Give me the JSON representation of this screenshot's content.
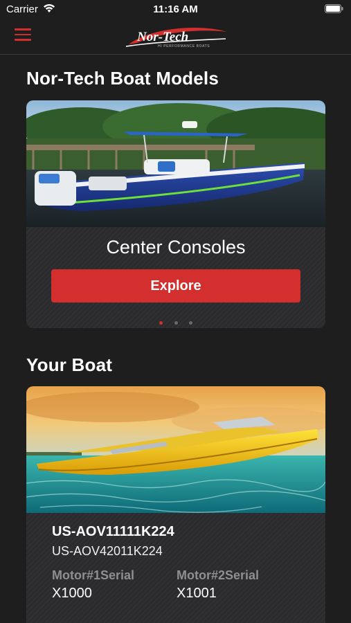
{
  "status_bar": {
    "carrier": "Carrier",
    "time": "11:16 AM"
  },
  "nav": {
    "menu_icon": "hamburger-menu-icon",
    "logo_text": "Nor-Tech",
    "logo_tagline": "HI PERFORMANCE BOATS",
    "accent_color": "#d32f2f"
  },
  "models_section": {
    "title": "Nor-Tech Boat Models",
    "current_model": "Center Consoles",
    "explore_label": "Explore",
    "pages": 3,
    "active_page": 1
  },
  "your_boat_section": {
    "title": "Your Boat",
    "hull_id": "US-AOV11111K224",
    "hull_id_secondary": "US-AOV42011K224",
    "motors": [
      {
        "label": "Motor#1Serial",
        "value": "X1000"
      },
      {
        "label": "Motor#2Serial",
        "value": "X1001"
      }
    ]
  }
}
